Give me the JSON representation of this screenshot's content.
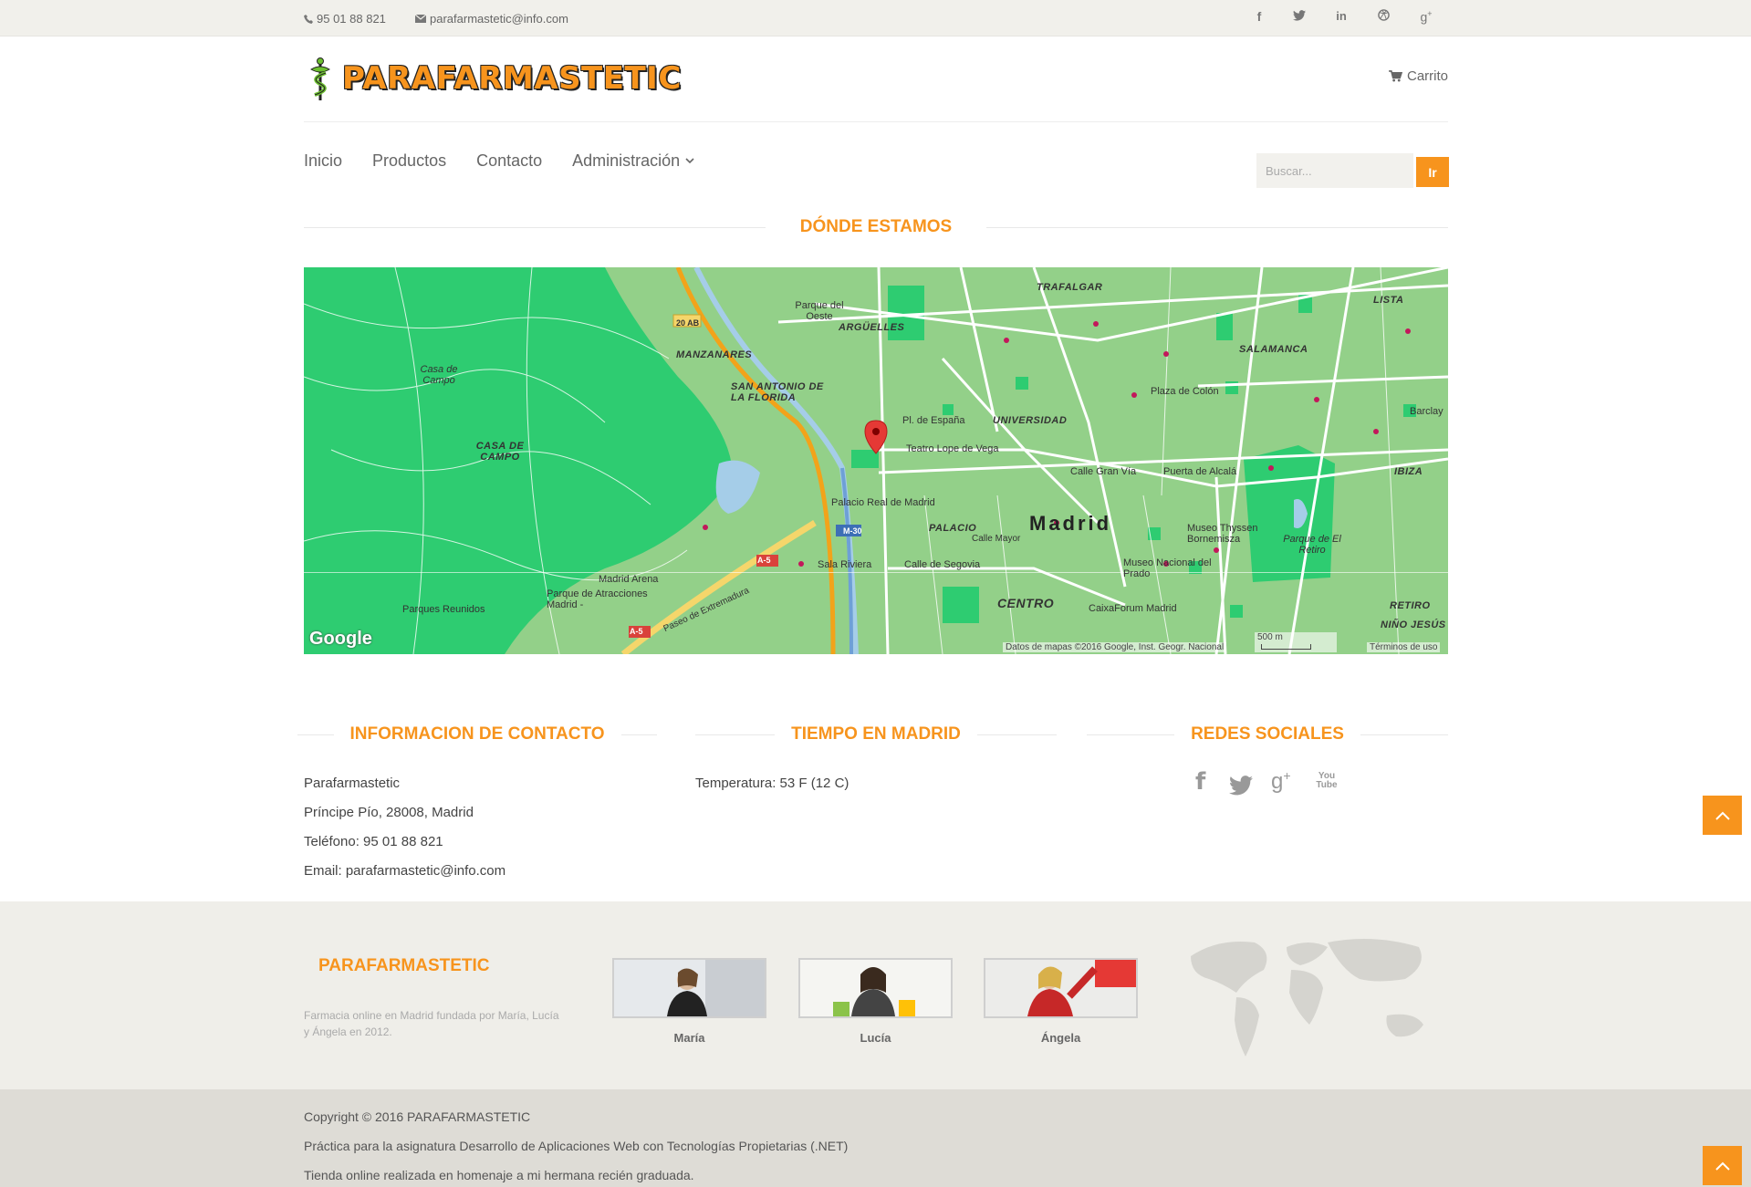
{
  "topbar": {
    "phone": "95 01 88 821",
    "email": "parafarmastetic@info.com",
    "social_icons": [
      "facebook-icon",
      "twitter-icon",
      "linkedin-icon",
      "dribbble-icon",
      "google-plus-icon"
    ]
  },
  "header": {
    "logo_text": "PARAFARMASTETIC",
    "cart_label": "Carrito"
  },
  "nav": {
    "items": [
      "Inicio",
      "Productos",
      "Contacto",
      "Administración"
    ],
    "search_placeholder": "Buscar...",
    "search_button": "Ir"
  },
  "map_section": {
    "title": "DÓNDE ESTAMOS",
    "labels": {
      "madrid": "Madrid",
      "trafalgar": "TRAFALGAR",
      "arguelles": "ARGÜELLES",
      "manzanares": "MANZANARES",
      "san_antonio": "SAN ANTONIO DE LA FLORIDA",
      "casa_campo": "Casa de Campo",
      "casa_campo_area": "CASA DE CAMPO",
      "universidad": "UNIVERSIDAD",
      "salamanca": "SALAMANCA",
      "palacio": "PALACIO",
      "centro": "CENTRO",
      "retiro": "RETIRO",
      "ibiza": "IBIZA",
      "lista": "LISTA",
      "nino_jesus": "NIÑO JESÚS",
      "plaza_colon": "Plaza de Colón",
      "plaza_espana": "Pl. de España",
      "teatro": "Teatro Lope de Vega",
      "gran_via": "Calle Gran Vía",
      "puerta_alcala": "Puerta de Alcalá",
      "palacio_real": "Palacio Real de Madrid",
      "thyssen": "Museo Thyssen Bornemisza",
      "prado": "Museo Nacional del Prado",
      "caixaforum": "CaixaForum Madrid",
      "retiro_park": "Parque de El Retiro",
      "sala_riviera": "Sala Riviera",
      "calle_segovia": "Calle de Segovia",
      "calle_mayor": "Calle Mayor",
      "madrid_arena": "Madrid Arena",
      "parque_atracciones": "Parque de Atracciones Madrid -",
      "parques_reunidos": "Parques Reunidos",
      "paseo_extremadura": "Paseo de Extremadura",
      "parque_oeste": "Parque del Oeste",
      "barclay": "Barclay",
      "m30": "M-30",
      "a5": "A-5",
      "ab20": "20 AB"
    },
    "google": "Google",
    "attribution": "Datos de mapas ©2016 Google, Inst. Geogr. Nacional",
    "scale": "500 m",
    "terms": "Términos de uso"
  },
  "contact": {
    "title": "INFORMACION DE CONTACTO",
    "lines": [
      "Parafarmastetic",
      "Príncipe Pío, 28008, Madrid",
      "Teléfono: 95 01 88 821",
      "Email: parafarmastetic@info.com"
    ]
  },
  "weather": {
    "title": "TIEMPO EN MADRID",
    "text": "Temperatura: 53 F (12 C)"
  },
  "social": {
    "title": "REDES SOCIALES",
    "icons": [
      "facebook-icon",
      "twitter-icon",
      "google-plus-icon",
      "youtube-icon"
    ],
    "youtube_text": "You Tube"
  },
  "footer": {
    "brand": "PARAFARMASTETIC",
    "description": "Farmacia online en Madrid fundada por María, Lucía y Ángela en 2012.",
    "people": [
      "María",
      "Lucía",
      "Ángela"
    ],
    "copyright": "Copyright © 2016 PARAFARMASTETIC",
    "line2": "Práctica para la asignatura Desarrollo de Aplicaciones Web con Tecnologías Propietarias (.NET)",
    "line3": "Tienda online realizada en homenaje a mi hermana recién graduada."
  },
  "colors": {
    "accent": "#f7941d",
    "topbar_bg": "#f1f0eb",
    "footer_bg": "#efeee9",
    "footer_bottom_bg": "#dedcd6",
    "map_green": "#2ecc71"
  }
}
